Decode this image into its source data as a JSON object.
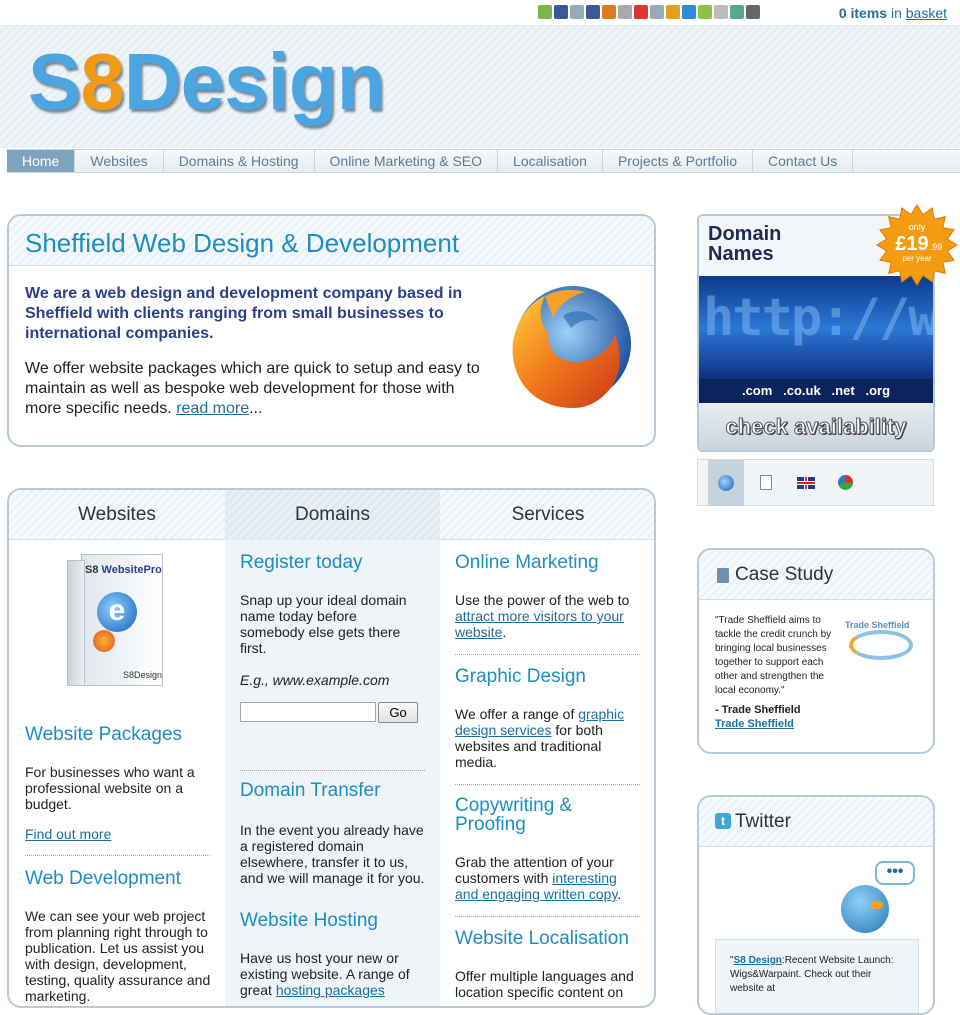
{
  "topbar": {
    "basket_count": "0 items",
    "basket_in": "in",
    "basket_link": "basket",
    "social_colors": [
      "#7ab648",
      "#3b5998",
      "#9ab",
      "#3b5998",
      "#e07a1f",
      "#aaa",
      "#d33",
      "#9ab",
      "#e0a020",
      "#2a8fd4",
      "#8bc34a",
      "#bbb",
      "#5a8",
      "#666"
    ]
  },
  "header": {
    "logo_a": "S",
    "logo_b": "8",
    "logo_c": "Design"
  },
  "nav": [
    "Home",
    "Websites",
    "Domains & Hosting",
    "Online Marketing & SEO",
    "Localisation",
    "Projects & Portfolio",
    "Contact Us"
  ],
  "intro": {
    "title": "Sheffield Web Design & Development",
    "lead": "We are a web design and development company based in Sheffield with clients ranging from small businesses to international companies.",
    "body": "We offer website packages which are quick to setup and easy to maintain as well as bespoke web development for those with more specific needs.",
    "read_more": "read more",
    "ellipsis": "..."
  },
  "columns": {
    "websites": {
      "heading": "Websites",
      "box_brand": "S8",
      "box_title": "WebsitePro",
      "box_footer": "S8Design",
      "packages_title": "Website Packages",
      "packages_text": "For businesses who want a professional website on a budget.",
      "find_out": "Find out more",
      "dev_title": "Web Development",
      "dev_text": "We can see your web project from planning right through to publication. Let us assist you with design, development, testing, quality assurance and marketing."
    },
    "domains": {
      "heading": "Domains",
      "register_title": "Register today",
      "register_text": "Snap up your ideal domain name today before somebody else gets there first.",
      "example": "E.g., www.example.com",
      "input_value": "",
      "go": "Go",
      "transfer_title": "Domain Transfer",
      "transfer_text": "In the event you already have a registered domain elsewhere, transfer it to us, and we will manage it for you.",
      "hosting_title": "Website Hosting",
      "hosting_text_a": "Have us host your new or existing website. A range of great",
      "hosting_link": "hosting packages"
    },
    "services": {
      "heading": "Services",
      "om_title": "Online Marketing",
      "om_text_a": "Use the power of the web to",
      "om_link": "attract more visitors to your website",
      "om_text_b": ".",
      "gd_title": "Graphic Design",
      "gd_text_a": "We offer a range of",
      "gd_link": "graphic design services",
      "gd_text_b": "for both websites and traditional media.",
      "cw_title": "Copywriting & Proofing",
      "cw_text_a": "Grab the attention of your customers with",
      "cw_link": "interesting and engaging written copy",
      "cw_text_b": ".",
      "loc_title": "Website Localisation",
      "loc_text": "Offer multiple languages and location specific content on"
    }
  },
  "domain_ad": {
    "title_a": "Domain",
    "title_b": "Names",
    "badge_only": "only",
    "badge_price": "£19",
    "badge_pence": ".99",
    "badge_per": "per year",
    "url_text": "http://www.",
    "tlds": ".com   .co.uk   .net   .org",
    "check": "check availability"
  },
  "case_study": {
    "title": "Case Study",
    "quote": "\"Trade Sheffield aims to tackle the credit crunch by bringing local businesses together to support each other and strengthen the local economy.\"",
    "author": "- Trade Sheffield",
    "link": "Trade Sheffield",
    "logo_text": "Trade Sheffield"
  },
  "twitter": {
    "title": "Twitter",
    "bubble": "•••",
    "tweet_link": "S8 Design",
    "tweet_quote": "\"",
    "tweet_text": ":Recent Website Launch: Wigs&Warpaint. Check out their website at"
  }
}
